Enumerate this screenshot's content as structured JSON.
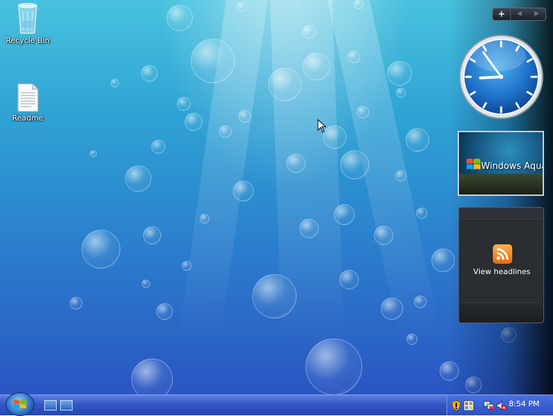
{
  "desktop": {
    "icons": [
      {
        "label": "Recycle Bin",
        "icon": "recycle-bin-icon"
      },
      {
        "label": "Readme",
        "icon": "text-document-icon"
      }
    ]
  },
  "sidebar": {
    "controls": {
      "add": "+",
      "prev": "◀",
      "next": "▶"
    },
    "clock": {
      "hour": 8,
      "minute": 54
    },
    "slideshow": {
      "caption": "Windows Aqua"
    },
    "feed": {
      "label": "View headlines",
      "icon": "rss-icon"
    }
  },
  "taskbar": {
    "start": {
      "icon": "windows-logo-icon"
    },
    "quick_launch": [
      {
        "icon": "show-desktop-icon"
      },
      {
        "icon": "switch-windows-icon"
      }
    ],
    "tray": {
      "icons": [
        "security-shield-icon",
        "windows-update-icon",
        "network-icon",
        "volume-muted-icon"
      ],
      "time": "8:54 PM"
    }
  },
  "colors": {
    "accent": "#2a6ec6",
    "taskbar": "#3457c6"
  }
}
